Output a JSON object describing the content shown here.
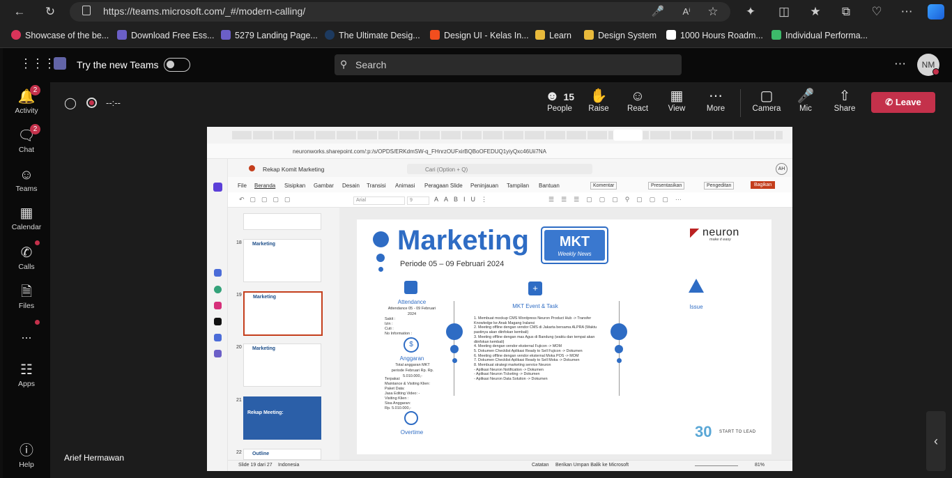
{
  "browser": {
    "url": "https://teams.microsoft.com/_#/modern-calling/",
    "bookmarks": [
      "Showcase of the be...",
      "Download Free Ess...",
      "5279 Landing Page...",
      "The Ultimate Desig...",
      "Design UI - Kelas In...",
      "Learn",
      "Design System",
      "1000 Hours Roadm...",
      "Individual Performa..."
    ]
  },
  "teams": {
    "try_new": "Try the new Teams",
    "search_placeholder": "Search",
    "avatar": "NM",
    "rail": [
      {
        "label": "Activity",
        "badge": "2"
      },
      {
        "label": "Chat",
        "badge": "2"
      },
      {
        "label": "Teams"
      },
      {
        "label": "Calendar"
      },
      {
        "label": "Calls"
      },
      {
        "label": "Files"
      },
      {
        "label": "..."
      },
      {
        "label": "Apps"
      },
      {
        "label": "Help"
      }
    ]
  },
  "meeting": {
    "timer": "--:--",
    "people_count": "15",
    "controls": [
      "People",
      "Raise",
      "React",
      "View",
      "More",
      "Camera",
      "Mic",
      "Share"
    ],
    "leave": "Leave",
    "presenter": "Arief Hermawan"
  },
  "shared": {
    "url": "neuronworks.sharepoint.com/:p:/s/OPDS/ERKdmSW-q_FHnrzOUFxirBQBoOFEDUQ1yiyQxc46Uii7NA",
    "doc_title": "Rekap Komit Marketing",
    "search": "Cari (Option + Q)",
    "user_initials": "AH",
    "menu": [
      "File",
      "Beranda",
      "Sisipkan",
      "Gambar",
      "Desain",
      "Transisi",
      "Animasi",
      "Peragaan Slide",
      "Peninjauan",
      "Tampilan",
      "Bantuan"
    ],
    "menu_right": [
      "Komentar",
      "Presentasikan",
      "Pengeditan",
      "Bagikan"
    ],
    "font": "Arial",
    "font_size": "9",
    "thumbnails": [
      {
        "num": "18",
        "title": "Marketing"
      },
      {
        "num": "19",
        "title": "Marketing"
      },
      {
        "num": "20",
        "title": "Marketing"
      },
      {
        "num": "21",
        "title": "Rekap Meeting:"
      },
      {
        "num": "22",
        "title": "Outline"
      }
    ],
    "slide": {
      "title": "Marketing",
      "badge_main": "MKT",
      "badge_sub": "Weekly News",
      "period": "Periode 05 – 09 Februari 2024",
      "brand": "neuron",
      "brand_tag": "make it easy",
      "attendance_title": "Attendance",
      "attendance_sub": "Attendance 05 - 09 Februari 2024",
      "attendance_lines": [
        "Sakit :",
        "Izin :",
        "Cuti :",
        "No Information :"
      ],
      "anggaran_title": "Anggaran",
      "anggaran_sub": "Total anggaran MKT periode Februari Rp. Rp. 5.010.000,-",
      "anggaran_lines": [
        "Terpakai:",
        "Maintance & Visiting Klien:",
        "Paket Data:",
        "Jasa Editing Video: -",
        "Visiting Klien :",
        "Sisa Anggaran:",
        "Rp. 5.010.000,-"
      ],
      "overtime_title": "Overtime",
      "event_title": "MKT Event & Task",
      "tasks": [
        "1. Membuat mockup CMS Wordpress Neuron Product Hub -> Transfer Knowledge ke Anak Magang Iralansi",
        "2. Meeting offline dengan vendor CMS di Jakarta bersama ALPRA (Waktu pastinya akan diinfokan kembali)",
        "3. Meeting offline dengan mas Agus di Bandung (waktu dan tempat akan diinfokan kembali)",
        "4. Meeting dengan vendor eksternal Fujicon -> MOM",
        "5. Dokumen Checklist Aplikasi Ready to Sell Fujicon -> Dokumen",
        "6. Meeting offline dengan vendor eksternal Moka POS -> MOM",
        "7. Dokumen Checklist Aplikasi Ready to Sell Moka -> Dokumen",
        "8. Membuat strategi marketing service Neuron",
        "-   Aplikasi Neuron Notification -> Dokumen",
        "-   Aplikasi Neuron Ticketing -> Dokumen",
        "-   Aplikasi Neuron Data Solution -> Dokumen"
      ],
      "issue_title": "Issue",
      "footer_tag": "START TO LEAD",
      "footer_num": "30"
    },
    "status": {
      "slide_info": "Slide 19 dari 27",
      "language": "Indonesia",
      "notes": "Catatan",
      "feedback": "Berikan Umpan Balik ke Microsoft",
      "zoom": "81%"
    }
  }
}
